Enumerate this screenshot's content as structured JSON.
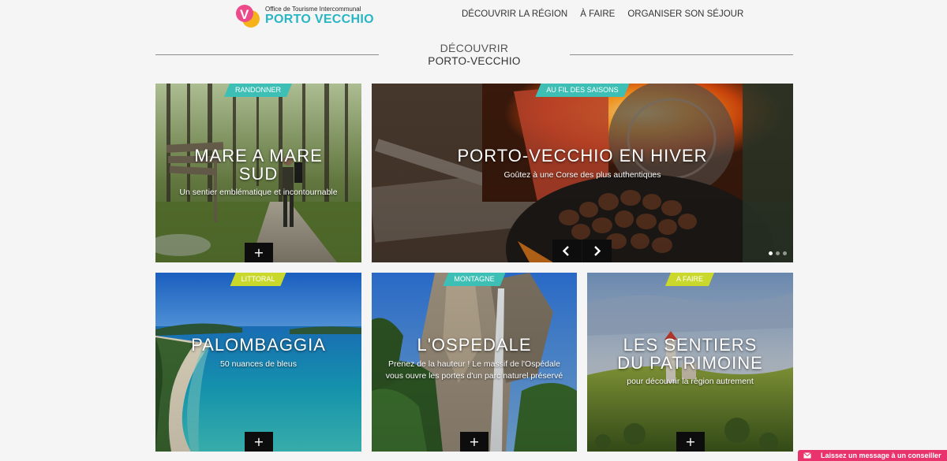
{
  "logo": {
    "badge_letter": "V",
    "tagline": "Office de Tourisme Intercommunal",
    "name": "PORTO VECCHIO"
  },
  "nav": {
    "items": [
      {
        "label": "DÉCOUVRIR LA RÉGION"
      },
      {
        "label": "À FAIRE"
      },
      {
        "label": "ORGANISER SON SÉJOUR"
      }
    ]
  },
  "section": {
    "kicker": "DÉCOUVRIR",
    "title": "PORTO-VECCHIO"
  },
  "cards": {
    "mare": {
      "tag": "RANDONNER",
      "tag_color": "#3dbfb5",
      "title": "MARE A MARE SUD",
      "subtitle": "Un sentier emblématique et incontournable",
      "more": "+"
    },
    "hiver": {
      "tag": "AU FIL DES SAISONS",
      "tag_color": "#3dbfb5",
      "title": "PORTO-VECCHIO EN HIVER",
      "subtitle": "Goûtez à une Corse des plus authentiques"
    },
    "palombaggia": {
      "tag": "LITTORAL",
      "tag_color": "#c9d82a",
      "title": "PALOMBAGGIA",
      "subtitle": "50 nuances de bleus",
      "more": "+"
    },
    "ospedale": {
      "tag": "MONTAGNE",
      "tag_color": "#3dbfb5",
      "title": "L'OSPEDALE",
      "subtitle": "Prenez de la hauteur ! Le massif de l'Ospédale vous ouvre les portes d'un parc naturel préservé",
      "more": "+"
    },
    "sentiers": {
      "tag": "A FAIRE",
      "tag_color": "#c9d82a",
      "title": "LES SENTIERS DU PATRIMOINE",
      "subtitle": "pour découvrir la région autrement",
      "more": "+"
    }
  },
  "slider": {
    "slide_count": 3,
    "active_slide": 1
  },
  "chat": {
    "label": "Laissez un message à un conseiller",
    "color": "#e8336d"
  }
}
